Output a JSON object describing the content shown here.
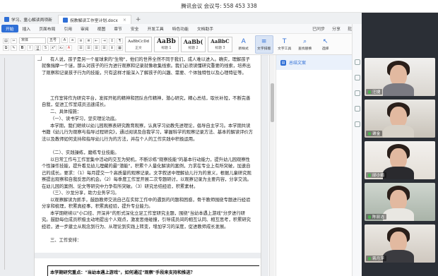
{
  "meeting": {
    "title": "腾讯会议 会议号: 558 453 338"
  },
  "tabs": [
    {
      "label": "学习、童心解读两项新",
      "active": false
    },
    {
      "label": "拐教解读工作室计划.docx",
      "active": true
    }
  ],
  "menu": [
    "开始",
    "插入",
    "页面布局",
    "引用",
    "审阅",
    "视图",
    "章节",
    "安全",
    "开发工具",
    "特色功能",
    "文档助手"
  ],
  "menu_right": [
    "已同步",
    "分享",
    "批注"
  ],
  "ribbon": {
    "font": "宋体",
    "size": "五号",
    "styles": [
      {
        "preview": "AaBbCcDd",
        "name": "正文"
      },
      {
        "preview": "AaBb",
        "name": "标题 1"
      },
      {
        "preview": "AaBb(",
        "name": "标题 2"
      },
      {
        "preview": "AaBbC",
        "name": "标题 3"
      }
    ],
    "buttons": [
      "新样式",
      "文字排版",
      "文字工具",
      "查找替换",
      "选择"
    ],
    "active_button": "文字排版"
  },
  "document": {
    "paragraphs": [
      "有人说，孩子是另一个星球来的\"生物\"，他们的世界全然不同于我们，成人难以进入。确实，理解孩子就像揣摩一个谜，那么对孩子的行为进行观察和记录就像收集线索。我们必须读懂研究重要的线索，培养出了观察和记录孩子行为的技能，只有这样才能深入了解孩子的兴趣、需要、个体独特性以及心理特征等。",
      "工作室将作为研究平台，发挥开拓的精神和团队合作精神，潜心研究，精心总结，取长补短，不断完善自我，促进工作室成员迅速成长。",
      "二、具体措施：",
      "（一）、读书学习，坚实理论功底。",
      "本学期，我们继续以幼儿园观察表研究教育观察，认真学习幼教先进理论，倡导自主学习。本学期共读书籍《幼儿行为观察与指导过程研究》，通过阅读及自我学习，掌握科学的观察记录方法、基本的解读评价方法以及教师如何支持和指导幼儿行为的方法，并在个人的工作实践中积极运用。",
      "（二）、实践操练，磨练专业技能。",
      "以日常工作与工作室集中活动的交互为契机，不断诊练\"观察技能\"的基本行动能力，提升幼儿园观察性个性操作技能，提升看见幼儿埋藏的最\"潜能\"，积累个人量化解读的案例，力求在专业上有所突破，加速自己的成长。要求：（1）每月提交一个高质量的观察记录。文字叙述中理解幼儿行为的意义，根据儿童研究观察提出观察和自我反思的机会。（2）每季度工作室开展二次专题研讨，以观察记录为主要内容，分享交流。在幼儿园的案例、论文等研究中力争有所突破。（3）研究总结经验，积累素材。",
      "（三）、沙龙分享，助力业务学习。",
      "以观察解读为抓手，鼓励教师交流自己在实际工作中的遇到的问题和困惑，骨干教师围绕专题进行经验分享和梳理，积累真经事，积累真经验，提升专业能力。",
      "本学期继续以\"小口径、开深井\"的形式深化立足工作室研究主题，围绕\"当幼本遇上游戏\"分步进行研究。鼓励每位成员积极主动地提出个人观点，激发思维碰撞，引导成员间的相互认同、相互思考，积累研究经验，进一步建立从观念到行为、从理论到实践上转变，增加学习的深度，促进教师成长发展。",
      "三、工作安排："
    ],
    "page2_heading": "本学期研究重点：\"当幼本遇上游戏\"，如何通过\"观察\"手段来支持和推进？"
  },
  "right_panel": {
    "items": [
      "总结文案"
    ]
  },
  "participants": [
    {
      "name": "汪捷"
    },
    {
      "name": "谢金"
    },
    {
      "name": "邱小娟"
    },
    {
      "name": "陈丽洁"
    },
    {
      "name": "蒋月萍"
    }
  ]
}
